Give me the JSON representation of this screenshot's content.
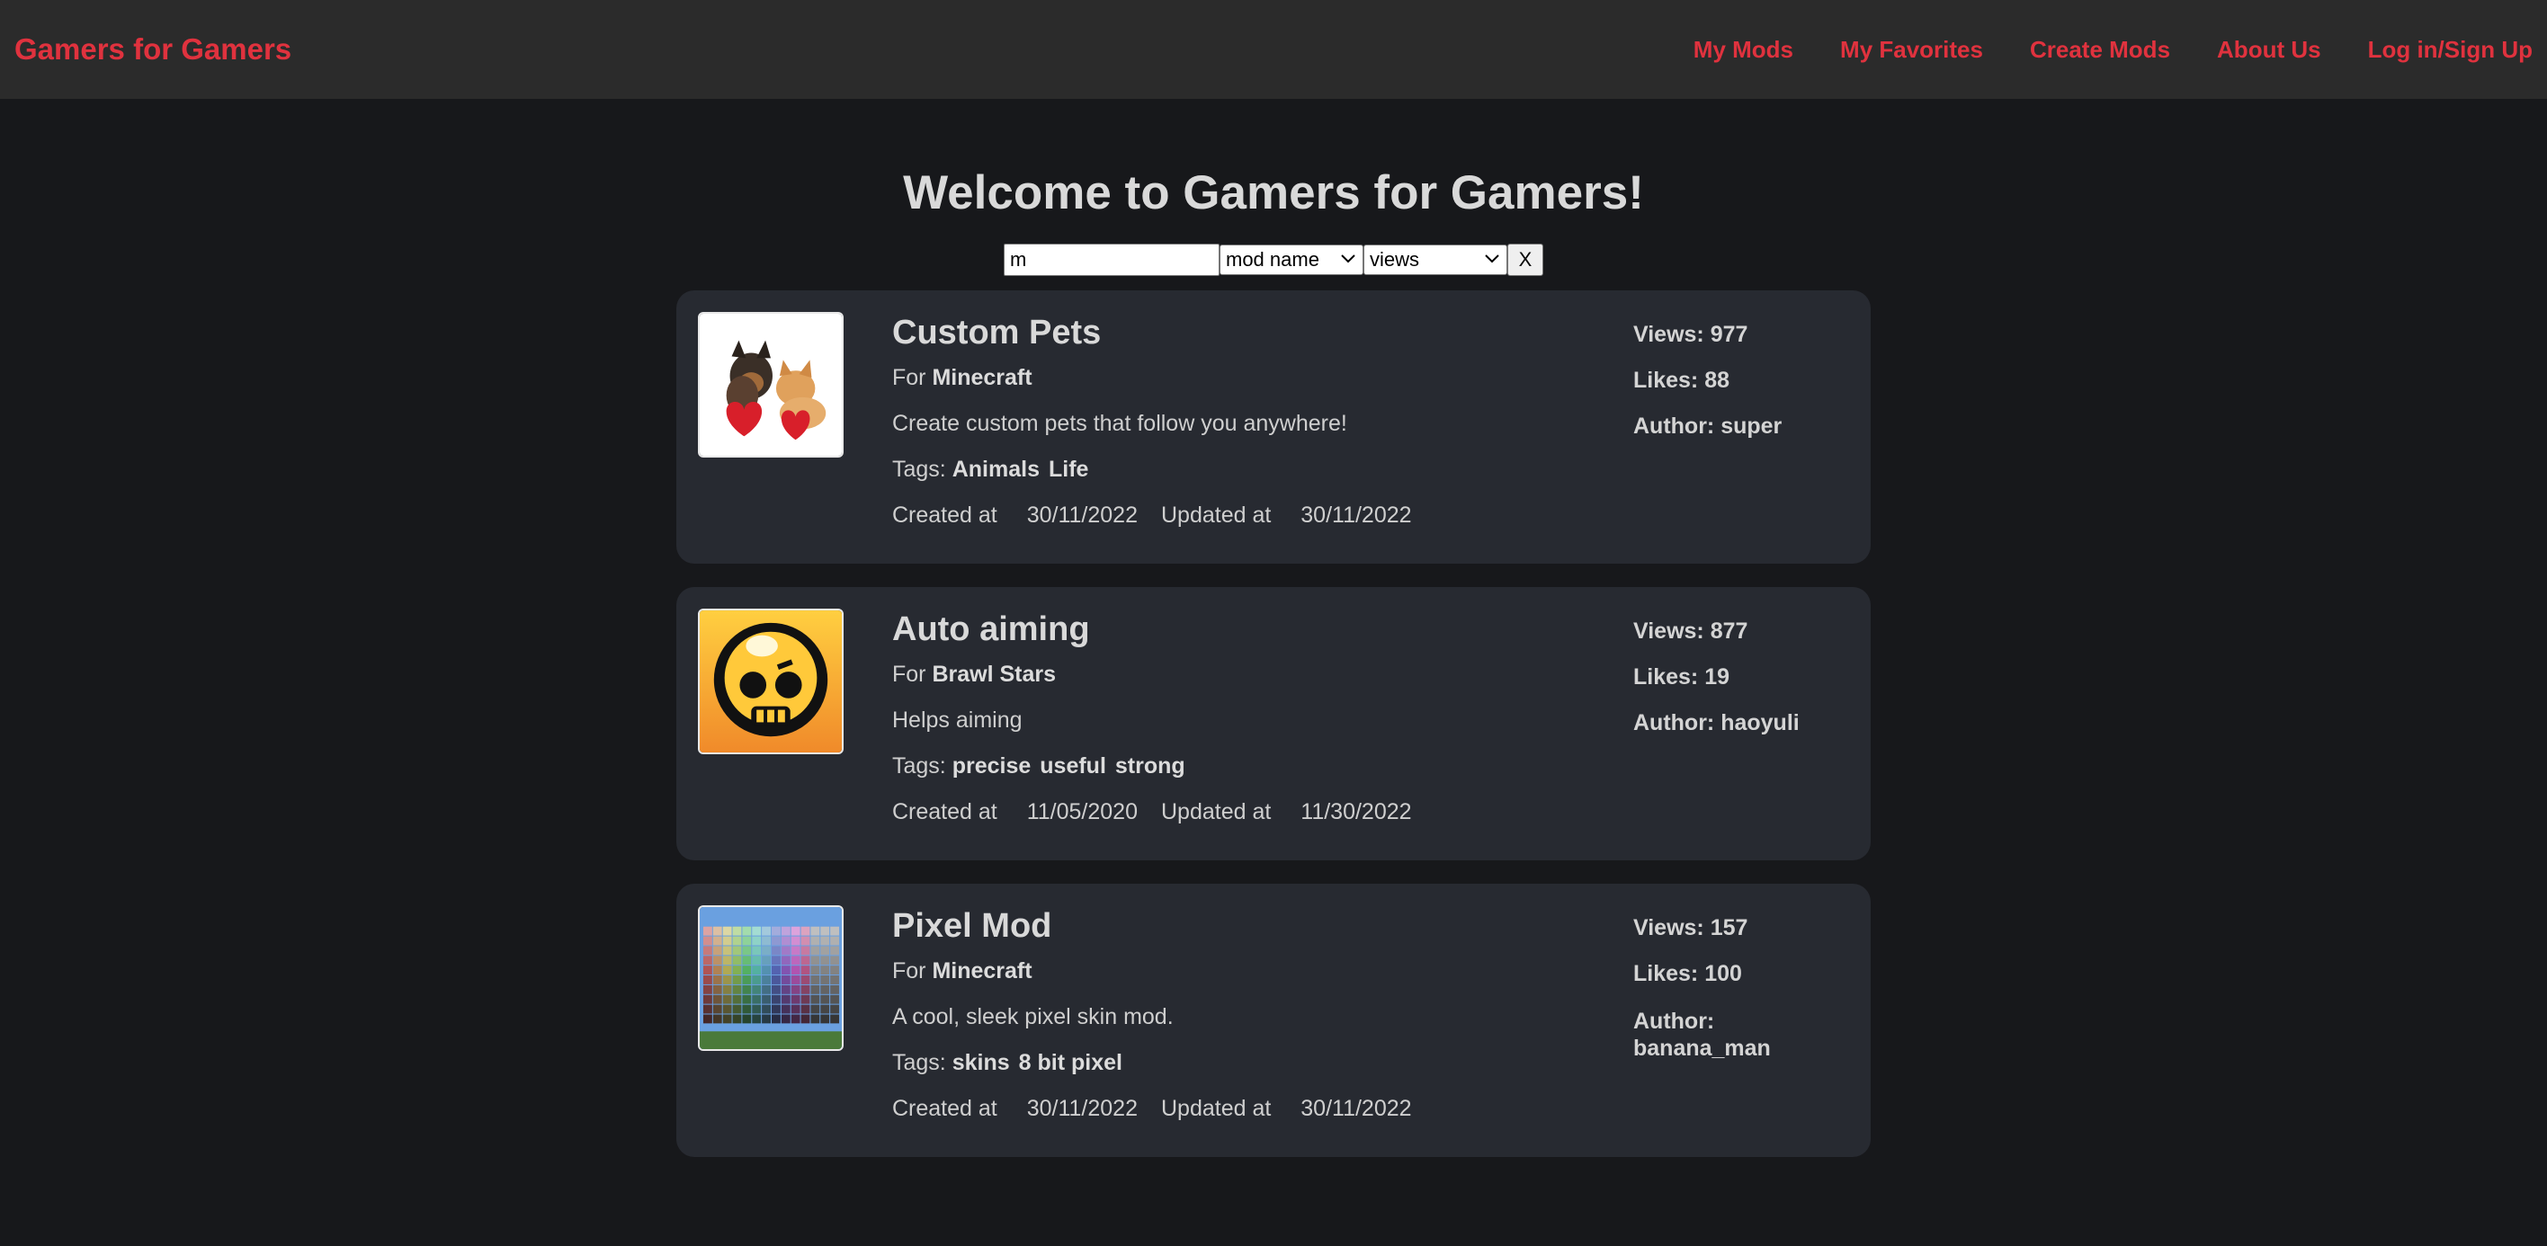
{
  "nav": {
    "brand": "Gamers for Gamers",
    "links": [
      "My Mods",
      "My Favorites",
      "Create Mods",
      "About Us",
      "Log in/Sign Up"
    ]
  },
  "page_title": "Welcome to Gamers for Gamers!",
  "search": {
    "value": "m",
    "field_selected": "mod name",
    "sort_selected": "views",
    "clear_label": "X"
  },
  "labels": {
    "for": "For",
    "tags": "Tags:",
    "created": "Created at",
    "updated": "Updated at",
    "views": "Views:",
    "likes": "Likes:",
    "author": "Author:"
  },
  "mods": [
    {
      "name": "Custom Pets",
      "game": "Minecraft",
      "description": "Create custom pets that follow you anywhere!",
      "tags": [
        "Animals",
        "Life"
      ],
      "created": "30/11/2022",
      "updated": "30/11/2022",
      "views": "977",
      "likes": "88",
      "author": "super",
      "image": "pets-photo"
    },
    {
      "name": "Auto aiming",
      "game": "Brawl Stars",
      "description": "Helps aiming",
      "tags": [
        "precise",
        "useful",
        "strong"
      ],
      "created": "11/05/2020",
      "updated": "11/30/2022",
      "views": "877",
      "likes": "19",
      "author": "haoyuli",
      "image": "brawl-stars-skull-logo"
    },
    {
      "name": "Pixel Mod",
      "game": "Minecraft",
      "description": "A cool, sleek pixel skin mod.",
      "tags": [
        "skins",
        "8 bit pixel"
      ],
      "created": "30/11/2022",
      "updated": "30/11/2022",
      "views": "157",
      "likes": "100",
      "author": "banana_man",
      "image": "pixel-palette"
    }
  ],
  "colors": {
    "accent": "#e0323e",
    "background": "#17181b",
    "navbar": "#2b2b2b",
    "card": "#272a31"
  }
}
